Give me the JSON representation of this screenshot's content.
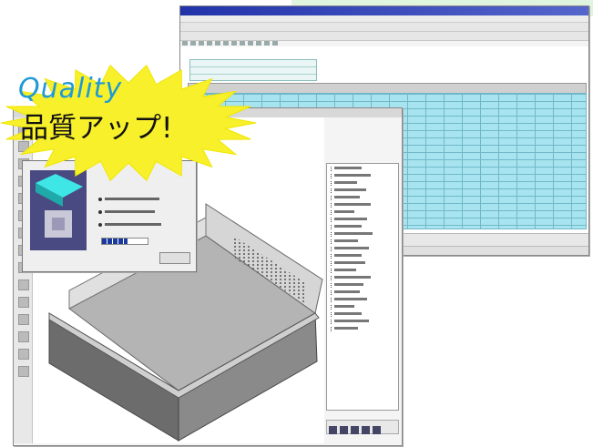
{
  "promo": {
    "quality_label": "Quality",
    "jp_label": "品質アップ!",
    "burst_color": "#f7f02a",
    "quality_color": "#1e9ad6"
  },
  "progress": {
    "fraction": 0.55
  },
  "colors": {
    "grid_fill": "#a8e4ef",
    "dialog_thumb": "#4a4a82",
    "titlebar": "#2233aa"
  }
}
